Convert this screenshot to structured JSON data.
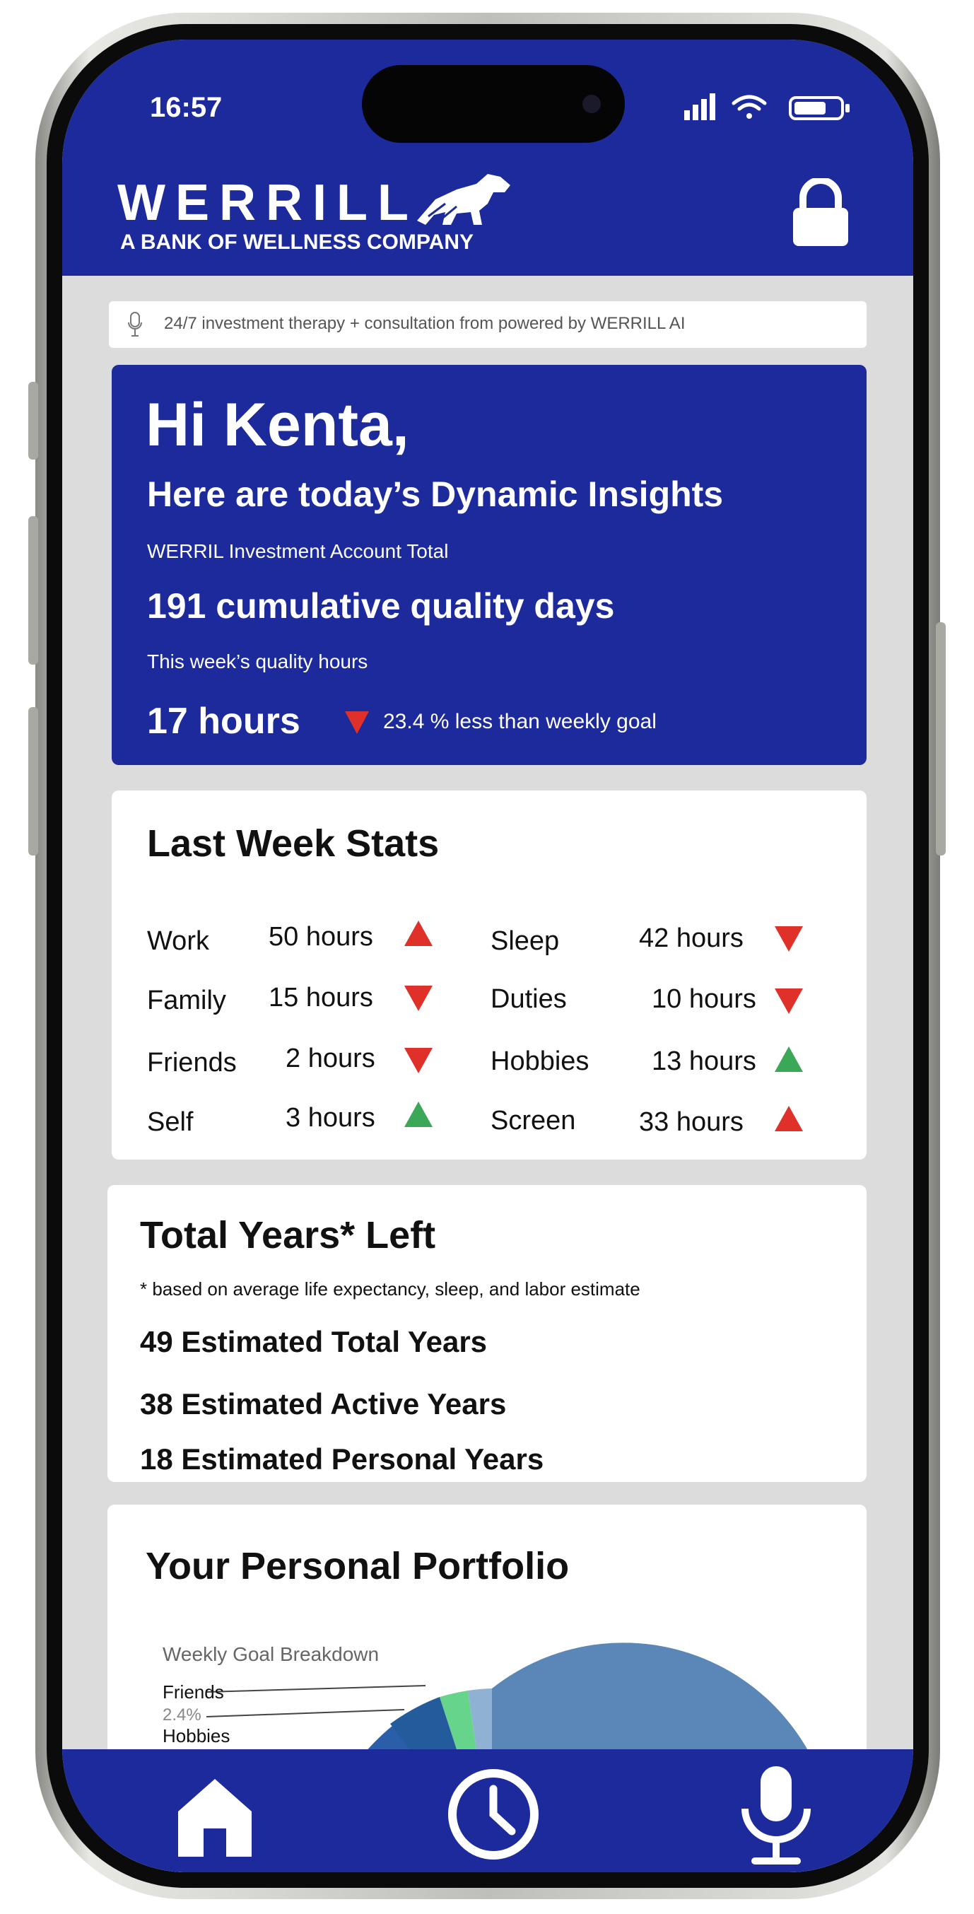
{
  "status": {
    "time": "16:57"
  },
  "brand": {
    "name": "WERRILL",
    "tagline": "A BANK OF WELLNESS COMPANY"
  },
  "ai_bar": {
    "text": "24/7 investment therapy + consultation from powered by WERRILL AI"
  },
  "insights": {
    "greeting": "Hi Kenta,",
    "title": "Here are today’s Dynamic Insights",
    "account_label": "WERRIL Investment Account Total",
    "quality_days": "191 cumulative quality days",
    "week_label": "This week’s quality hours",
    "week_hours": "17 hours",
    "goal_note": "23.4 % less than weekly goal"
  },
  "stats": {
    "title": "Last Week Stats",
    "left": [
      {
        "label": "Work",
        "value": "50 hours",
        "trend": "up"
      },
      {
        "label": "Family",
        "value": "15 hours",
        "trend": "down"
      },
      {
        "label": "Friends",
        "value": "2 hours",
        "trend": "down"
      },
      {
        "label": "Self",
        "value": "3 hours",
        "trend": "up-good"
      }
    ],
    "right": [
      {
        "label": "Sleep",
        "value": "42 hours",
        "trend": "down"
      },
      {
        "label": "Duties",
        "value": "10 hours",
        "trend": "down"
      },
      {
        "label": "Hobbies",
        "value": "13 hours",
        "trend": "up-good"
      },
      {
        "label": "Screen",
        "value": "33 hours",
        "trend": "up"
      }
    ]
  },
  "years": {
    "title": "Total Years* Left",
    "note": "* based on average life expectancy, sleep, and labor estimate",
    "total": "49 Estimated Total Years",
    "active": "38 Estimated Active Years",
    "personal": "18 Estimated Personal Years"
  },
  "portfolio": {
    "title": "Your Personal Portfolio",
    "chart_title": "Weekly Goal Breakdown",
    "label_friends": "Friends",
    "pct_friends": "2.4%",
    "label_hobbies": "Hobbies"
  },
  "chart_data": {
    "type": "pie",
    "title": "Weekly Goal Breakdown",
    "slices": [
      {
        "label": "Friends",
        "value": 2.4
      },
      {
        "label": "Hobbies"
      }
    ]
  },
  "colors": {
    "brand_blue": "#1c2a9c",
    "trend_up": "#e0302a",
    "trend_down": "#e0302a",
    "trend_good": "#3aa856"
  },
  "icons": {
    "status": [
      "signal-icon",
      "wifi-icon",
      "battery-icon"
    ],
    "header": [
      "lion-logo-icon",
      "lock-icon"
    ],
    "nav": [
      "home-icon",
      "clock-icon",
      "microphone-icon"
    ]
  }
}
